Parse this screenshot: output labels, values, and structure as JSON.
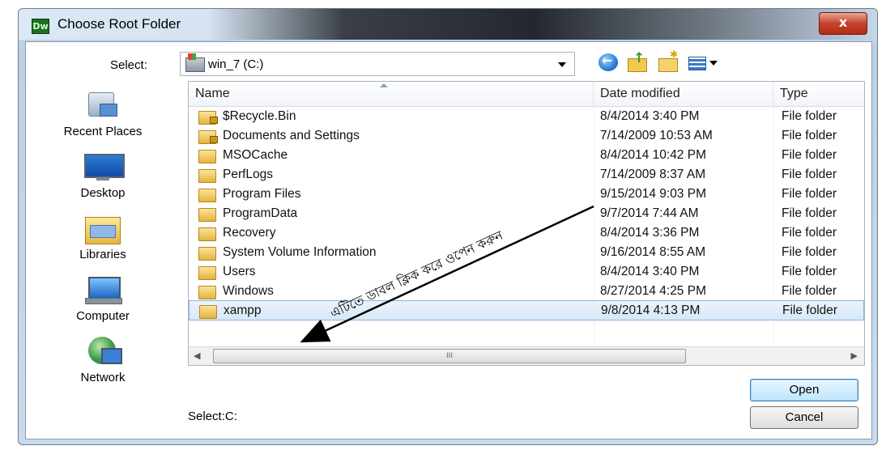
{
  "window": {
    "app_icon": "Dw",
    "title": "Choose Root Folder",
    "close_glyph": "x"
  },
  "toolbar": {
    "select_label": "Select:",
    "location": "win_7 (C:)",
    "icons": [
      "back-icon",
      "up-folder-icon",
      "new-folder-icon",
      "views-menu-icon"
    ]
  },
  "places": [
    {
      "label": "Recent Places",
      "icon": "recent-places-icon"
    },
    {
      "label": "Desktop",
      "icon": "desktop-icon"
    },
    {
      "label": "Libraries",
      "icon": "libraries-icon"
    },
    {
      "label": "Computer",
      "icon": "computer-icon"
    },
    {
      "label": "Network",
      "icon": "network-icon"
    }
  ],
  "columns": {
    "name": "Name",
    "date": "Date modified",
    "type": "Type"
  },
  "rows": [
    {
      "name": "$Recycle.Bin",
      "date": "8/4/2014 3:40 PM",
      "type": "File folder",
      "locked": true
    },
    {
      "name": "Documents and Settings",
      "date": "7/14/2009 10:53 AM",
      "type": "File folder",
      "locked": true
    },
    {
      "name": "MSOCache",
      "date": "8/4/2014 10:42 PM",
      "type": "File folder",
      "locked": false
    },
    {
      "name": "PerfLogs",
      "date": "7/14/2009 8:37 AM",
      "type": "File folder",
      "locked": false
    },
    {
      "name": "Program Files",
      "date": "9/15/2014 9:03 PM",
      "type": "File folder",
      "locked": false
    },
    {
      "name": "ProgramData",
      "date": "9/7/2014 7:44 AM",
      "type": "File folder",
      "locked": false
    },
    {
      "name": "Recovery",
      "date": "8/4/2014 3:36 PM",
      "type": "File folder",
      "locked": false
    },
    {
      "name": "System Volume Information",
      "date": "9/16/2014 8:55 AM",
      "type": "File folder",
      "locked": false
    },
    {
      "name": "Users",
      "date": "8/4/2014 3:40 PM",
      "type": "File folder",
      "locked": false
    },
    {
      "name": "Windows",
      "date": "8/27/2014 4:25 PM",
      "type": "File folder",
      "locked": false
    },
    {
      "name": "xampp",
      "date": "9/8/2014 4:13 PM",
      "type": "File folder",
      "locked": false,
      "selected": true
    }
  ],
  "scrollbar": {
    "thumb_grip": "III"
  },
  "annotation": {
    "text": "এটিতে ডাবল ক্লিক করে ওপেন করুন"
  },
  "footer": {
    "select_path": "Select:C:",
    "open_label": "Open",
    "cancel_label": "Cancel"
  },
  "colors": {
    "accent": "#3c7fb1",
    "selection": "#d8e8f7",
    "close": "#c7432b"
  }
}
